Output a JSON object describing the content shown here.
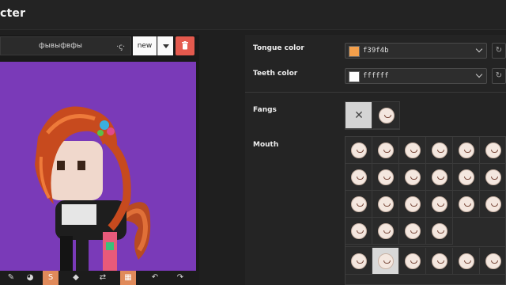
{
  "window": {
    "title": "cter"
  },
  "editor": {
    "name_value": "фывыфвфы",
    "name_symbol": "·ꞔ·",
    "preset_value": "new",
    "canvas_color": "#7a3ab8",
    "tools": [
      {
        "name": "brush-icon",
        "glyph": "✎",
        "active": false
      },
      {
        "name": "palette-icon",
        "glyph": "◕",
        "active": false
      },
      {
        "name": "strike-icon",
        "glyph": "S",
        "active": true
      },
      {
        "name": "fill-icon",
        "glyph": "◆",
        "active": false
      },
      {
        "name": "swap-icon",
        "glyph": "⇄",
        "active": false
      },
      {
        "name": "grid-icon",
        "glyph": "▦",
        "active": true
      },
      {
        "name": "undo-icon",
        "glyph": "↶",
        "active": false
      },
      {
        "name": "redo-icon",
        "glyph": "↷",
        "active": false
      }
    ]
  },
  "settings": {
    "tongue_label": "Tongue color",
    "tongue_value": "f39f4b",
    "tongue_swatch": "#f39f4b",
    "teeth_label": "Teeth color",
    "teeth_value": "ffffff",
    "teeth_swatch": "#ffffff",
    "fangs_label": "Fangs",
    "mouth_label": "Mouth",
    "fangs_options": [
      "none",
      "fang-1"
    ],
    "mouth_options_count": 24,
    "mouth_selected_index": 21
  }
}
